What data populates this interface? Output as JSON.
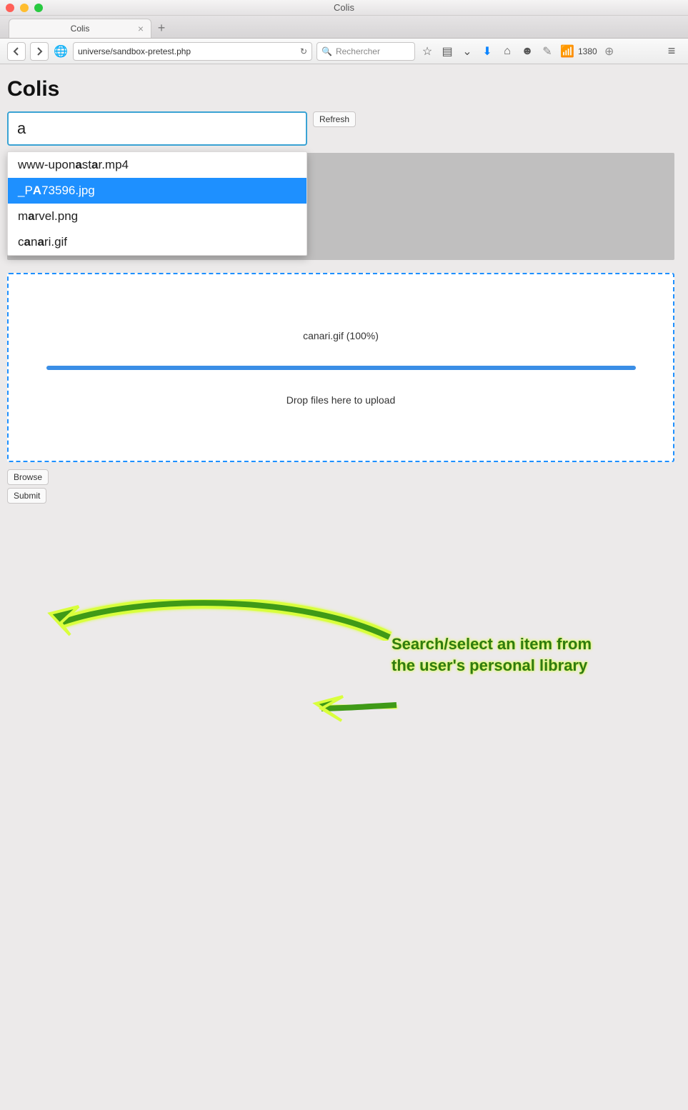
{
  "window": {
    "title": "Colis"
  },
  "browser": {
    "tab_title": "Colis",
    "url": "universe/sandbox-pretest.php",
    "search_placeholder": "Rechercher",
    "rss_count": "1380"
  },
  "page": {
    "title": "Colis",
    "search_value": "a",
    "refresh_label": "Refresh",
    "browse_label": "Browse",
    "submit_label": "Submit"
  },
  "autocomplete": {
    "items": [
      {
        "pre": "www-upon",
        "bold": "a",
        "mid": "st",
        "bold2": "a",
        "post": "r.mp4",
        "selected": false
      },
      {
        "pre": "_P",
        "bold": "A",
        "mid": "73596.jpg",
        "bold2": "",
        "post": "",
        "selected": true
      },
      {
        "pre": "m",
        "bold": "a",
        "mid": "rvel.png",
        "bold2": "",
        "post": "",
        "selected": false
      },
      {
        "pre": "c",
        "bold": "a",
        "mid": "n",
        "bold2": "a",
        "post": "ri.gif",
        "selected": false
      }
    ]
  },
  "upload": {
    "file_status": "canari.gif  (100%)",
    "drop_text": "Drop files here to upload",
    "progress_percent": 100
  },
  "annotation": {
    "line1": "Search/select an item from",
    "line2": "the user's personal library"
  }
}
